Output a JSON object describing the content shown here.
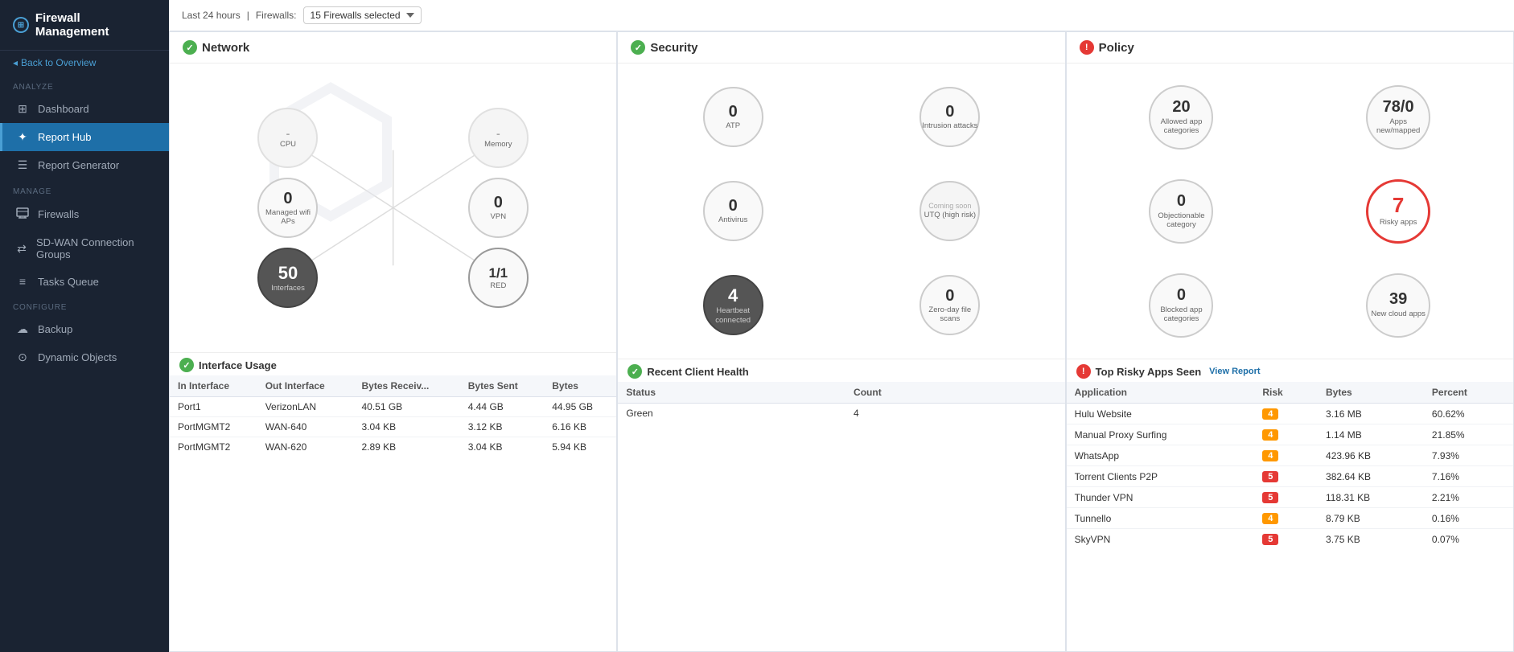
{
  "sidebar": {
    "logo": "Firewall Management",
    "back_label": "Back to Overview",
    "sections": [
      {
        "label": "ANALYZE",
        "items": [
          {
            "id": "dashboard",
            "label": "Dashboard",
            "icon": "⊞",
            "active": false
          },
          {
            "id": "report-hub",
            "label": "Report Hub",
            "icon": "✦",
            "active": true
          },
          {
            "id": "report-generator",
            "label": "Report Generator",
            "icon": "☰",
            "active": false
          }
        ]
      },
      {
        "label": "MANAGE",
        "items": [
          {
            "id": "firewalls",
            "label": "Firewalls",
            "icon": "🔥",
            "active": false
          },
          {
            "id": "sd-wan",
            "label": "SD-WAN Connection Groups",
            "icon": "⇄",
            "active": false
          },
          {
            "id": "tasks",
            "label": "Tasks Queue",
            "icon": "≡",
            "active": false
          }
        ]
      },
      {
        "label": "CONFIGURE",
        "items": [
          {
            "id": "backup",
            "label": "Backup",
            "icon": "☁",
            "active": false
          },
          {
            "id": "dynamic-objects",
            "label": "Dynamic Objects",
            "icon": "⊙",
            "active": false
          }
        ]
      }
    ]
  },
  "topbar": {
    "time_range": "Last 24 hours",
    "firewalls_label": "Firewalls:",
    "firewalls_select": "15 Firewalls selected"
  },
  "network": {
    "title": "Network",
    "nodes": {
      "cpu": {
        "value": "-",
        "label": "CPU"
      },
      "memory": {
        "value": "-",
        "label": "Memory"
      },
      "managed_wifi": {
        "value": "0",
        "label": "Managed wifi APs"
      },
      "vpn": {
        "value": "0",
        "label": "VPN"
      },
      "interfaces": {
        "value": "50",
        "label": "Interfaces"
      },
      "red": {
        "value": "1/1",
        "label": "RED"
      }
    },
    "interface_usage": {
      "title": "Interface Usage",
      "columns": [
        "In Interface",
        "Out Interface",
        "Bytes Receiv...",
        "Bytes Sent",
        "Bytes"
      ],
      "rows": [
        [
          "Port1",
          "VerizonLAN",
          "40.51 GB",
          "4.44 GB",
          "44.95 GB"
        ],
        [
          "PortMGMT2",
          "WAN-640",
          "3.04 KB",
          "3.12 KB",
          "6.16 KB"
        ],
        [
          "PortMGMT2",
          "WAN-620",
          "2.89 KB",
          "3.04 KB",
          "5.94 KB"
        ]
      ]
    }
  },
  "security": {
    "title": "Security",
    "nodes": {
      "atp": {
        "value": "0",
        "label": "ATP"
      },
      "intrusion": {
        "value": "0",
        "label": "Intrusion attacks"
      },
      "antivirus": {
        "value": "0",
        "label": "Antivirus"
      },
      "utq": {
        "value": "Coming soon",
        "label": "UTQ (high risk)"
      },
      "heartbeat": {
        "value": "4",
        "label": "Heartbeat connected"
      },
      "zero_day": {
        "value": "0",
        "label": "Zero-day file scans"
      }
    },
    "client_health": {
      "title": "Recent Client Health",
      "columns": [
        "Status",
        "Count"
      ],
      "rows": [
        [
          "Green",
          "4"
        ]
      ]
    }
  },
  "policy": {
    "title": "Policy",
    "nodes": {
      "allowed_app": {
        "value": "20",
        "label": "Allowed app categories"
      },
      "apps_new": {
        "value": "78/0",
        "label": "Apps new/mapped"
      },
      "objectionable": {
        "value": "0",
        "label": "Objectionable category"
      },
      "risky_apps": {
        "value": "7",
        "label": "Risky apps"
      },
      "blocked_app": {
        "value": "0",
        "label": "Blocked app categories"
      },
      "new_cloud": {
        "value": "39",
        "label": "New cloud apps"
      }
    },
    "top_risky": {
      "title": "Top Risky Apps Seen",
      "view_report": "View Report",
      "columns": [
        "Application",
        "Risk",
        "Bytes",
        "Percent"
      ],
      "rows": [
        [
          "Hulu Website",
          "4",
          "3.16 MB",
          "60.62%"
        ],
        [
          "Manual Proxy Surfing",
          "4",
          "1.14 MB",
          "21.85%"
        ],
        [
          "WhatsApp",
          "4",
          "423.96 KB",
          "7.93%"
        ],
        [
          "Torrent Clients P2P",
          "5",
          "382.64 KB",
          "7.16%"
        ],
        [
          "Thunder VPN",
          "5",
          "118.31 KB",
          "2.21%"
        ],
        [
          "Tunnello",
          "4",
          "8.79 KB",
          "0.16%"
        ],
        [
          "SkyVPN",
          "5",
          "3.75 KB",
          "0.07%"
        ]
      ]
    }
  }
}
